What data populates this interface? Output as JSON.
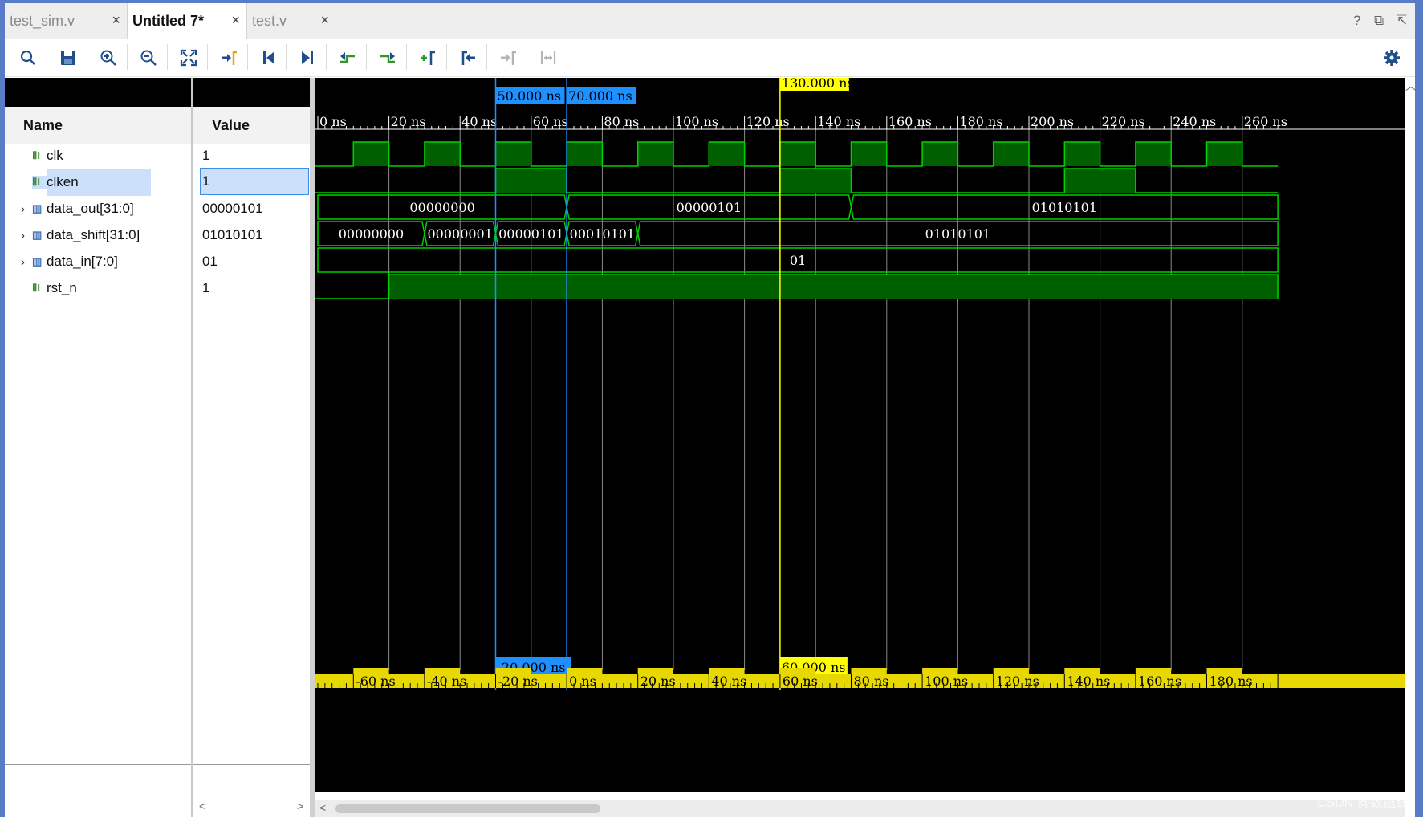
{
  "tabs": [
    {
      "label": "test_sim.v",
      "close": "×"
    },
    {
      "label": "Untitled 7*",
      "close": "×"
    },
    {
      "label": "test.v",
      "close": "×"
    }
  ],
  "window_controls": {
    "help": "?",
    "restore": "⧉",
    "float": "⇱"
  },
  "toolbar": {
    "icons": [
      "search-icon",
      "save-icon",
      "zoom-in-icon",
      "zoom-out-icon",
      "zoom-fit-icon",
      "go-to-cursor-icon",
      "go-to-time-zero-icon",
      "go-to-last-time-icon",
      "previous-transition-icon",
      "next-transition-icon",
      "add-marker-icon",
      "previous-marker-icon",
      "next-marker-icon",
      "swap-cursors-icon",
      "settings-icon"
    ]
  },
  "columns": {
    "name": "Name",
    "value": "Value"
  },
  "signals": [
    {
      "name": "clk",
      "value": "1",
      "kind": "bit",
      "expandable": false
    },
    {
      "name": "clken",
      "value": "1",
      "kind": "bit",
      "expandable": false,
      "selected": true
    },
    {
      "name": "data_out[31:0]",
      "value": "00000101",
      "kind": "bus",
      "expandable": true
    },
    {
      "name": "data_shift[31:0]",
      "value": "01010101",
      "kind": "bus",
      "expandable": true
    },
    {
      "name": "data_in[7:0]",
      "value": "01",
      "kind": "bus",
      "expandable": true
    },
    {
      "name": "rst_n",
      "value": "1",
      "kind": "bit",
      "expandable": false
    }
  ],
  "timeline": {
    "unit": "ns",
    "start": 0,
    "end": 270,
    "major_tick": 20,
    "tick_labels": [
      "0 ns",
      "20 ns",
      "40 ns",
      "60 ns",
      "80 ns",
      "100 ns",
      "120 ns",
      "140 ns",
      "160 ns",
      "180 ns",
      "200 ns",
      "220 ns",
      "240 ns",
      "260 ns"
    ]
  },
  "markers": {
    "marker_a": {
      "time": 50,
      "label": "50.000 ns"
    },
    "marker_b": {
      "time": 70,
      "label": "70.000 ns"
    },
    "cursor": {
      "time": 130,
      "label": "130.000 ns"
    }
  },
  "relative_timeline": {
    "tick_labels": [
      "-60 ns",
      "-40 ns",
      "-20 ns",
      "0 ns",
      "20 ns",
      "40 ns",
      "60 ns",
      "80 ns",
      "100 ns",
      "120 ns",
      "140 ns",
      "160 ns",
      "180 ns"
    ],
    "marker_a_delta": "-20.000 ns",
    "cursor_delta": "60.000 ns"
  },
  "waves": {
    "clk_period": 20,
    "clk_first_high": 10,
    "clken_high": [
      [
        50,
        70
      ],
      [
        130,
        150
      ],
      [
        210,
        230
      ]
    ],
    "rst_n_rise": 20,
    "data_out": [
      [
        0,
        70,
        "00000000"
      ],
      [
        70,
        150,
        "00000101"
      ],
      [
        150,
        270,
        "01010101"
      ]
    ],
    "data_shift": [
      [
        0,
        30,
        "00000000"
      ],
      [
        30,
        50,
        "00000001"
      ],
      [
        50,
        70,
        "00000101"
      ],
      [
        70,
        90,
        "00010101"
      ],
      [
        90,
        270,
        "01010101"
      ]
    ],
    "data_in": [
      [
        0,
        270,
        "01"
      ]
    ]
  },
  "colors": {
    "wave": "#00d000",
    "fill": "#006000",
    "marker": "#1e90ff",
    "cursor": "#ffff00",
    "grid": "#8a8a8a",
    "ruler": "#ffffff",
    "gold": "#e6d800"
  },
  "watermark": "CSDN @数据线"
}
